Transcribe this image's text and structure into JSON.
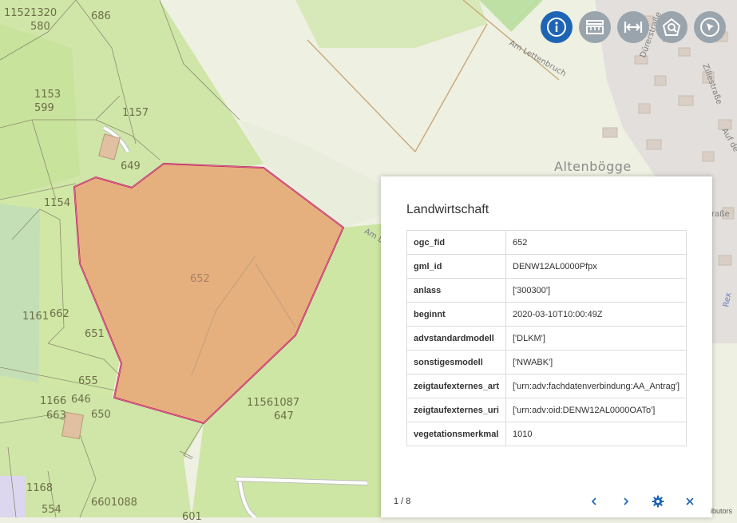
{
  "map": {
    "parcels": [
      {
        "id": "11521320",
        "kind": "label"
      },
      {
        "id": "580"
      },
      {
        "id": "686"
      },
      {
        "id": "1153"
      },
      {
        "id": "599"
      },
      {
        "id": "1157"
      },
      {
        "id": "649"
      },
      {
        "id": "1154"
      },
      {
        "id": "652"
      },
      {
        "id": "1161"
      },
      {
        "id": "662"
      },
      {
        "id": "651"
      },
      {
        "id": "655"
      },
      {
        "id": "1166"
      },
      {
        "id": "646"
      },
      {
        "id": "663"
      },
      {
        "id": "650"
      },
      {
        "id": "11561087"
      },
      {
        "id": "647"
      },
      {
        "id": "1168"
      },
      {
        "id": "554"
      },
      {
        "id": "6601088"
      },
      {
        "id": "601"
      }
    ],
    "streets": {
      "am_lettenbruch": "Am Lettenbruch",
      "durerstrasse": "Dürerstraße",
      "zillestrasse": "Zillestraße",
      "auf_de": "Auf de",
      "am_l": "Am L",
      "strasse_partial": "raße",
      "rex_partial": "Rex"
    },
    "place": "Altenbögge"
  },
  "toolbar": {
    "tools": [
      {
        "name": "info-tool",
        "icon": "info-icon",
        "active": true
      },
      {
        "name": "layer-tool",
        "icon": "layers-icon",
        "active": false
      },
      {
        "name": "measure-tool",
        "icon": "measure-icon",
        "active": false
      },
      {
        "name": "search-area-tool",
        "icon": "search-area-icon",
        "active": false
      },
      {
        "name": "select-tool",
        "icon": "cursor-icon",
        "active": false
      }
    ],
    "active_color": "#1e64b4",
    "inactive_color": "#9aa4ad"
  },
  "popup": {
    "title": "Landwirtschaft",
    "rows": [
      {
        "key": "ogc_fid",
        "value": "652"
      },
      {
        "key": "gml_id",
        "value": "DENW12AL0000Pfpx"
      },
      {
        "key": "anlass",
        "value": "['300300']"
      },
      {
        "key": "beginnt",
        "value": "2020-03-10T10:00:49Z"
      },
      {
        "key": "advstandardmodell",
        "value": "['DLKM']"
      },
      {
        "key": "sonstigesmodell",
        "value": "['NWABK']"
      },
      {
        "key": "zeigtaufexternes_art",
        "value": "['urn:adv:fachdatenverbindung:AA_Antrag']"
      },
      {
        "key": "zeigtaufexternes_uri",
        "value": "['urn:adv:oid:DENW12AL0000OATo']"
      },
      {
        "key": "vegetationsmerkmal",
        "value": "1010"
      }
    ],
    "pager": "1 / 8",
    "buttons": {
      "prev": "chevron-left-icon",
      "next": "chevron-right-icon",
      "settings": "gear-icon",
      "close": "close-icon"
    }
  },
  "attribution": "ibutors"
}
